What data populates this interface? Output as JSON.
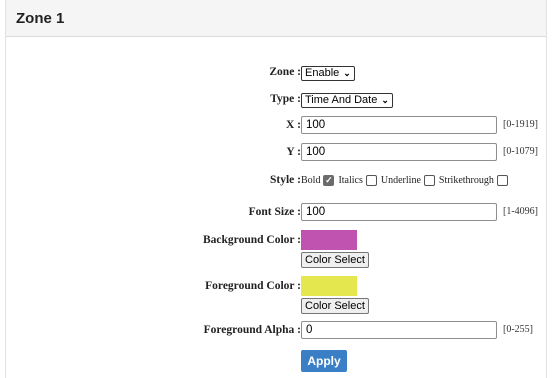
{
  "panel": {
    "title": "Zone 1"
  },
  "form": {
    "zone": {
      "label": "Zone :",
      "value": "Enable"
    },
    "type": {
      "label": "Type :",
      "value": "Time And Date"
    },
    "x": {
      "label": "X :",
      "value": "100",
      "range": "[0-1919]"
    },
    "y": {
      "label": "Y :",
      "value": "100",
      "range": "[0-1079]"
    },
    "style": {
      "label": "Style :",
      "options": [
        {
          "label": "Bold",
          "checked": true
        },
        {
          "label": "Italics",
          "checked": false
        },
        {
          "label": "Underline",
          "checked": false
        },
        {
          "label": "Strikethrough",
          "checked": false
        }
      ]
    },
    "font_size": {
      "label": "Font Size :",
      "value": "100",
      "range": "[1-4096]"
    },
    "background_color": {
      "label": "Background Color :",
      "color": "#c153b0",
      "button": "Color Select"
    },
    "foreground_color": {
      "label": "Foreground Color :",
      "color": "#e4e84e",
      "button": "Color Select"
    },
    "foreground_alpha": {
      "label": "Foreground Alpha :",
      "value": "0",
      "range": "[0-255]"
    },
    "apply_label": "Apply"
  }
}
